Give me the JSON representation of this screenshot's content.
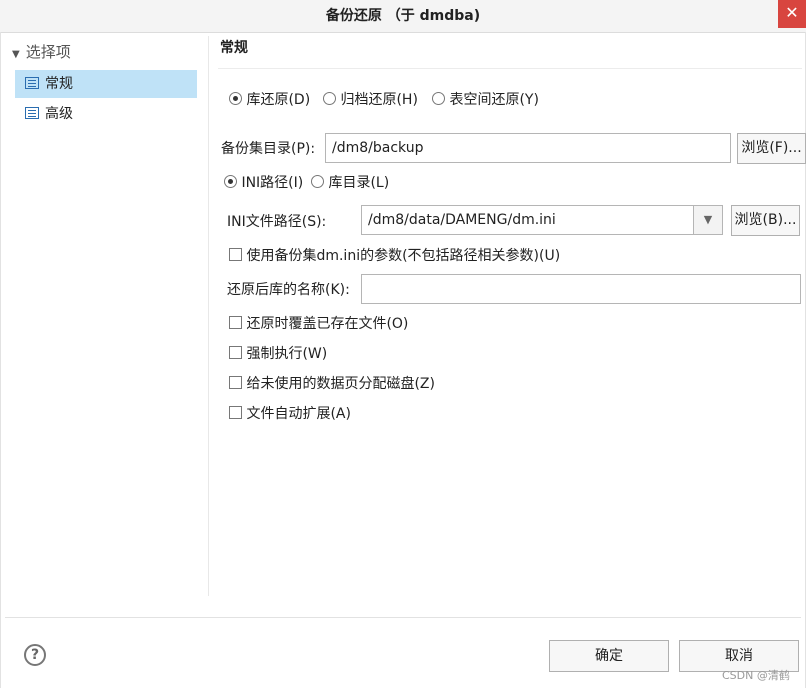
{
  "window": {
    "title": "备份还原 （于 dmdba)",
    "close_icon": "close-icon"
  },
  "sidebar": {
    "header": "选择项",
    "items": [
      {
        "label": "常规",
        "selected": true
      },
      {
        "label": "高级",
        "selected": false
      }
    ]
  },
  "main": {
    "section_title": "常规",
    "restore_type": {
      "options": [
        "库还原(D)",
        "归档还原(H)",
        "表空间还原(Y)"
      ],
      "selected": "库还原(D)"
    },
    "backup_dir": {
      "label": "备份集目录(P):",
      "value": "/dm8/backup",
      "browse_label": "浏览(F)..."
    },
    "path_type": {
      "options": [
        "INI路径(I)",
        "库目录(L)"
      ],
      "selected": "INI路径(I)"
    },
    "ini_path": {
      "label": "INI文件路径(S):",
      "value": "/dm8/data/DAMENG/dm.ini",
      "browse_label": "浏览(B)..."
    },
    "use_ini_params": {
      "label": "使用备份集dm.ini的参数(不包括路径相关参数)(U)",
      "checked": false
    },
    "db_name": {
      "label": "还原后库的名称(K):",
      "value": ""
    },
    "checkboxes": [
      {
        "label": "还原时覆盖已存在文件(O)",
        "checked": false
      },
      {
        "label": "强制执行(W)",
        "checked": false
      },
      {
        "label": "给未使用的数据页分配磁盘(Z)",
        "checked": false
      },
      {
        "label": "文件自动扩展(A)",
        "checked": false
      }
    ]
  },
  "footer": {
    "ok_label": "确定",
    "cancel_label": "取消",
    "help_icon": "help-icon"
  },
  "watermark": "CSDN @清鹤"
}
